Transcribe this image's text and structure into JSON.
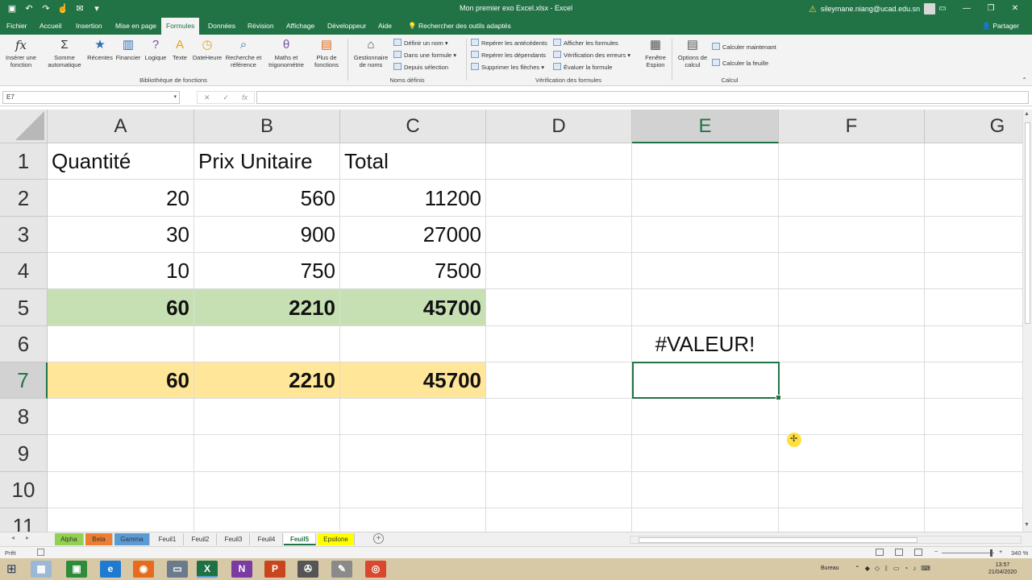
{
  "window": {
    "title": "Mon premier exo Excel.xlsx  -  Excel",
    "user": "sileymane.niang@ucad.edu.sn"
  },
  "tabs": [
    {
      "label": "Fichier"
    },
    {
      "label": "Accueil"
    },
    {
      "label": "Insertion"
    },
    {
      "label": "Mise en page"
    },
    {
      "label": "Formules",
      "active": true
    },
    {
      "label": "Données"
    },
    {
      "label": "Révision"
    },
    {
      "label": "Affichage"
    },
    {
      "label": "Développeur"
    },
    {
      "label": "Aide"
    }
  ],
  "tell_me": "Rechercher des outils adaptés",
  "share": "Partager",
  "ribbon": {
    "insert_function": "Insérer une fonction",
    "autosum": "Somme automatique",
    "recent": "Récentes",
    "financial": "Financier",
    "logical": "Logique",
    "text": "Texte",
    "datetime": "DateHeure",
    "lookup": "Recherche et référence",
    "math": "Maths et trigonométrie",
    "more": "Plus de fonctions",
    "library_group": "Bibliothèque de fonctions",
    "name_manager": "Gestionnaire de noms",
    "define_name": "Définir un nom",
    "use_in_formula": "Dans une formule",
    "from_selection": "Depuis sélection",
    "names_group": "Noms définis",
    "trace_precedents": "Repérer les antécédents",
    "trace_dependents": "Repérer les dépendants",
    "remove_arrows": "Supprimer les flèches",
    "show_formulas": "Afficher les formules",
    "error_checking": "Vérification des erreurs",
    "evaluate_formula": "Évaluer la formule",
    "watch_window": "Fenêtre Espion",
    "audit_group": "Vérification des formules",
    "calc_options": "Options de calcul",
    "calc_now": "Calculer maintenant",
    "calc_sheet": "Calculer la feuille",
    "calc_group": "Calcul"
  },
  "formula_bar": {
    "name_box": "E7",
    "formula": ""
  },
  "sheet": {
    "columns": [
      "A",
      "B",
      "C",
      "D",
      "E",
      "F",
      "G"
    ],
    "selected_column": "E",
    "rows": [
      "1",
      "2",
      "3",
      "4",
      "5",
      "6",
      "7",
      "8",
      "9",
      "10",
      "11"
    ],
    "selected_row": "7",
    "cells": {
      "A1": "Quantité",
      "B1": "Prix Unitaire",
      "C1": "Total",
      "A2": "20",
      "B2": "560",
      "C2": "11200",
      "A3": "30",
      "B3": "900",
      "C3": "27000",
      "A4": "10",
      "B4": "750",
      "C4": "7500",
      "A5": "60",
      "B5": "2210",
      "C5": "45700",
      "E6": "#VALEUR!",
      "A7": "60",
      "B7": "2210",
      "C7": "45700"
    },
    "fill_colors": {
      "row5": "#c6e0b4",
      "row7": "#ffe699"
    }
  },
  "sheet_tabs": [
    {
      "label": "Alpha",
      "color": "#92d050"
    },
    {
      "label": "Beta",
      "color": "#ed7d31"
    },
    {
      "label": "Gamma",
      "color": "#5b9bd5"
    },
    {
      "label": "Feuil1"
    },
    {
      "label": "Feuil2"
    },
    {
      "label": "Feuil3"
    },
    {
      "label": "Feuil4"
    },
    {
      "label": "Feuil5",
      "active": true
    },
    {
      "label": "Epsilone",
      "color": "#ffff00"
    }
  ],
  "status": {
    "ready": "Prêt",
    "zoom": "340 %"
  },
  "taskbar": {
    "desktop": "Bureau",
    "time": "13:57",
    "date": "21/04/2020"
  }
}
